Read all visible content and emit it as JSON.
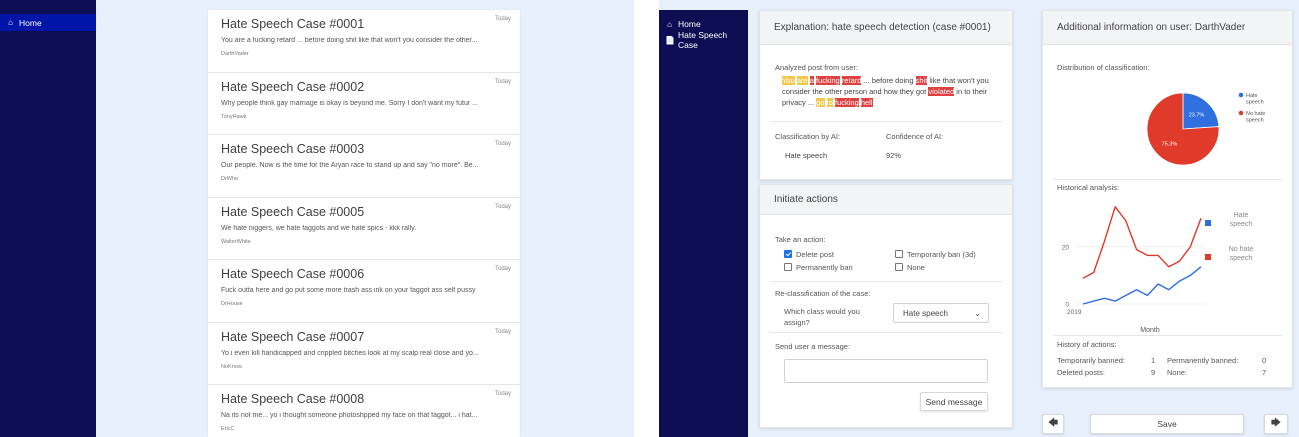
{
  "left_screen": {
    "sidebar": {
      "home_label": "Home",
      "home_icon": "home-icon"
    },
    "cases": [
      {
        "title": "Hate Speech Case #0001",
        "date": "Today",
        "text": "You are a fucking retard ... before doing shit like that won't you consider the other...",
        "user": "DarthVader"
      },
      {
        "title": "Hate Speech Case #0002",
        "date": "Today",
        "text": "Why people think gay marriage is okay is beyond me. Sorry I don't want my futur ...",
        "user": "TonyHawk"
      },
      {
        "title": "Hate Speech Case #0003",
        "date": "Today",
        "text": "Our people. Now is the time for the Aryan race to stand up and say \"no more\". Be...",
        "user": "DrWho"
      },
      {
        "title": "Hate Speech Case #0005",
        "date": "Today",
        "text": "We hate niggers, we hate faggots and we hate spics - kkk rally.",
        "user": "WalterWhite"
      },
      {
        "title": "Hate Speech Case #0006",
        "date": "Today",
        "text": "Fuck outta here and go put some more trash ass ink on your faggot ass self pussy",
        "user": "DrHouse"
      },
      {
        "title": "Hate Speech Case #0007",
        "date": "Today",
        "text": "Yo i even kill handicapped and crippled bitches look at my scalp real close and yo...",
        "user": "NoKnow"
      },
      {
        "title": "Hate Speech Case #0008",
        "date": "Today",
        "text": "Na its not me... yo i thought someone photoshpped my face on that faggot... i hat...",
        "user": "EricC"
      }
    ]
  },
  "right_screen": {
    "sidebar": {
      "home_label": "Home",
      "case_label": "Hate Speech Case",
      "home_icon": "home-icon",
      "case_icon": "document-icon"
    },
    "explanation": {
      "title": "Explanation: hate speech detection (case #0001)",
      "analyzed_label": "Analyzed post from user:",
      "post_segments": [
        {
          "text": "You",
          "hl": "y"
        },
        {
          "text": " ",
          "hl": ""
        },
        {
          "text": "are",
          "hl": "y"
        },
        {
          "text": " ",
          "hl": ""
        },
        {
          "text": "a",
          "hl": "r"
        },
        {
          "text": " ",
          "hl": ""
        },
        {
          "text": "fucking",
          "hl": "r"
        },
        {
          "text": " ",
          "hl": ""
        },
        {
          "text": "retard",
          "hl": "r"
        },
        {
          "text": " ... before doing ",
          "hl": ""
        },
        {
          "text": "shit",
          "hl": "r"
        },
        {
          "text": " like that won't you consider the other person and how they got ",
          "hl": ""
        },
        {
          "text": "violated",
          "hl": "r"
        },
        {
          "text": " in to their privacy ... ",
          "hl": ""
        },
        {
          "text": "go",
          "hl": "y"
        },
        {
          "text": " ",
          "hl": ""
        },
        {
          "text": "to",
          "hl": "y"
        },
        {
          "text": " ",
          "hl": ""
        },
        {
          "text": "fucking",
          "hl": "r"
        },
        {
          "text": " ",
          "hl": ""
        },
        {
          "text": "hell",
          "hl": "r"
        }
      ],
      "classification_label": "Classification by AI:",
      "classification_value": "Hate speech",
      "confidence_label": "Confidence of AI:",
      "confidence_value": "92%"
    },
    "actions": {
      "title": "Initiate actions",
      "take_action_label": "Take an action:",
      "options": [
        {
          "label": "Delete post",
          "checked": true
        },
        {
          "label": "Temporarily ban (3d)",
          "checked": false
        },
        {
          "label": "Permanently ban",
          "checked": false
        },
        {
          "label": "None",
          "checked": false
        }
      ],
      "reclass_label": "Re-classification of the case:",
      "question": "Which class would you assign?",
      "select_value": "Hate speech",
      "message_label": "Send user a message:",
      "message_value": "",
      "send_button": "Send message"
    },
    "user_info": {
      "title": "Additional information on user: DarthVader",
      "distribution_label": "Distribution of classification:",
      "historical_label": "Historical analysis:",
      "history_label": "History of actions:",
      "history": {
        "temp_banned_label": "Temporarily banned:",
        "temp_banned_value": "1",
        "perm_banned_label": "Permanently banned:",
        "perm_banned_value": "0",
        "deleted_label": "Deleted posts:",
        "deleted_value": "9",
        "none_label": "None:",
        "none_value": "7"
      }
    },
    "colors": {
      "hate": "#2f6fe0",
      "no_hate": "#e03a2a"
    },
    "footer": {
      "prev_icon": "arrow-left-icon",
      "save_label": "Save",
      "next_icon": "arrow-right-icon"
    }
  },
  "chart_data": [
    {
      "type": "pie",
      "title": "",
      "labels": [
        "Hate speech",
        "No hate speech"
      ],
      "values": [
        23.7,
        75.3
      ],
      "value_labels": [
        "23.7%",
        "75.3%"
      ],
      "colors": [
        "#2f6fe0",
        "#e03a2a"
      ],
      "legend": "right"
    },
    {
      "type": "line",
      "title": "",
      "xlabel": "Month",
      "x_tick_labels": [
        "2019"
      ],
      "y_tick_labels": [
        "0",
        "20"
      ],
      "ylim": [
        0,
        36
      ],
      "grid": true,
      "legend": "right",
      "x": [
        0,
        1,
        2,
        3,
        4,
        5,
        6,
        7,
        8,
        9,
        10,
        11
      ],
      "series": [
        {
          "name": "Hate speech",
          "color": "#2f6fe0",
          "values": [
            0,
            1,
            2,
            1,
            3,
            5,
            3,
            7,
            5,
            8,
            10,
            13
          ]
        },
        {
          "name": "No hate speech",
          "color": "#e03a2a",
          "values": [
            9,
            11,
            22,
            34,
            29,
            19,
            17,
            17,
            13,
            15,
            20,
            30
          ]
        }
      ]
    }
  ]
}
